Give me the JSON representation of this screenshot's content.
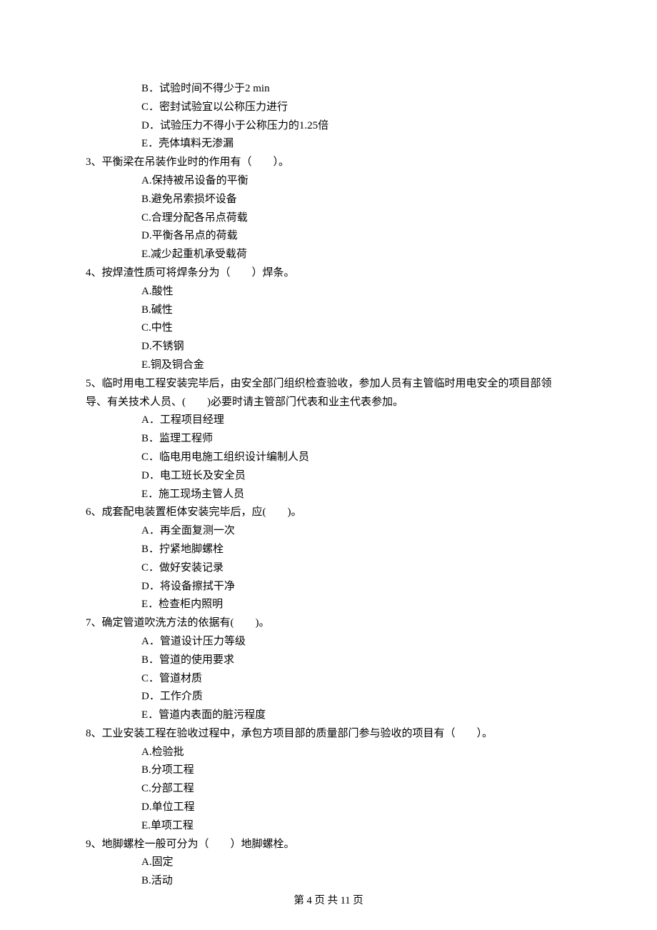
{
  "preOptions": [
    "B．试验时间不得少于2 min",
    "C．密封试验宜以公称压力进行",
    "D．试验压力不得小于公称压力的1.25倍",
    "E．壳体填料无渗漏"
  ],
  "questions": [
    {
      "stem": "3、平衡梁在吊装作业时的作用有（　　）。",
      "options": [
        "A.保持被吊设备的平衡",
        "B.避免吊索损坏设备",
        "C.合理分配各吊点荷载",
        "D.平衡各吊点的荷载",
        "E.减少起重机承受载荷"
      ]
    },
    {
      "stem": "4、按焊渣性质可将焊条分为（　　）焊条。",
      "options": [
        "A.酸性",
        "B.碱性",
        "C.中性",
        "D.不锈钢",
        "E.铜及铜合金"
      ]
    },
    {
      "stem": "5、临时用电工程安装完毕后，由安全部门组织检查验收，参加人员有主管临时用电安全的项目部领导、有关技术人员、(　　)必要时请主管部门代表和业主代表参加。",
      "options": [
        "A．工程项目经理",
        "B．监理工程师",
        "C．临电用电施工组织设计编制人员",
        "D．电工班长及安全员",
        "E．施工现场主管人员"
      ]
    },
    {
      "stem": "6、成套配电装置柜体安装完毕后，应(　　)。",
      "options": [
        "A．再全面复测一次",
        "B．拧紧地脚螺栓",
        "C．做好安装记录",
        "D．将设备擦拭干净",
        "E．检查柜内照明"
      ]
    },
    {
      "stem": "7、确定管道吹洗方法的依据有(　　)。",
      "options": [
        "A．管道设计压力等级",
        "B．管道的使用要求",
        "C．管道材质",
        "D．工作介质",
        "E．管道内表面的脏污程度"
      ]
    },
    {
      "stem": "8、工业安装工程在验收过程中，承包方项目部的质量部门参与验收的项目有（　　）。",
      "options": [
        "A.检验批",
        "B.分项工程",
        "C.分部工程",
        "D.单位工程",
        "E.单项工程"
      ]
    },
    {
      "stem": "9、地脚螺栓一般可分为（　　）地脚螺栓。",
      "options": [
        "A.固定",
        "B.活动"
      ]
    }
  ],
  "footer": "第 4 页 共 11 页"
}
